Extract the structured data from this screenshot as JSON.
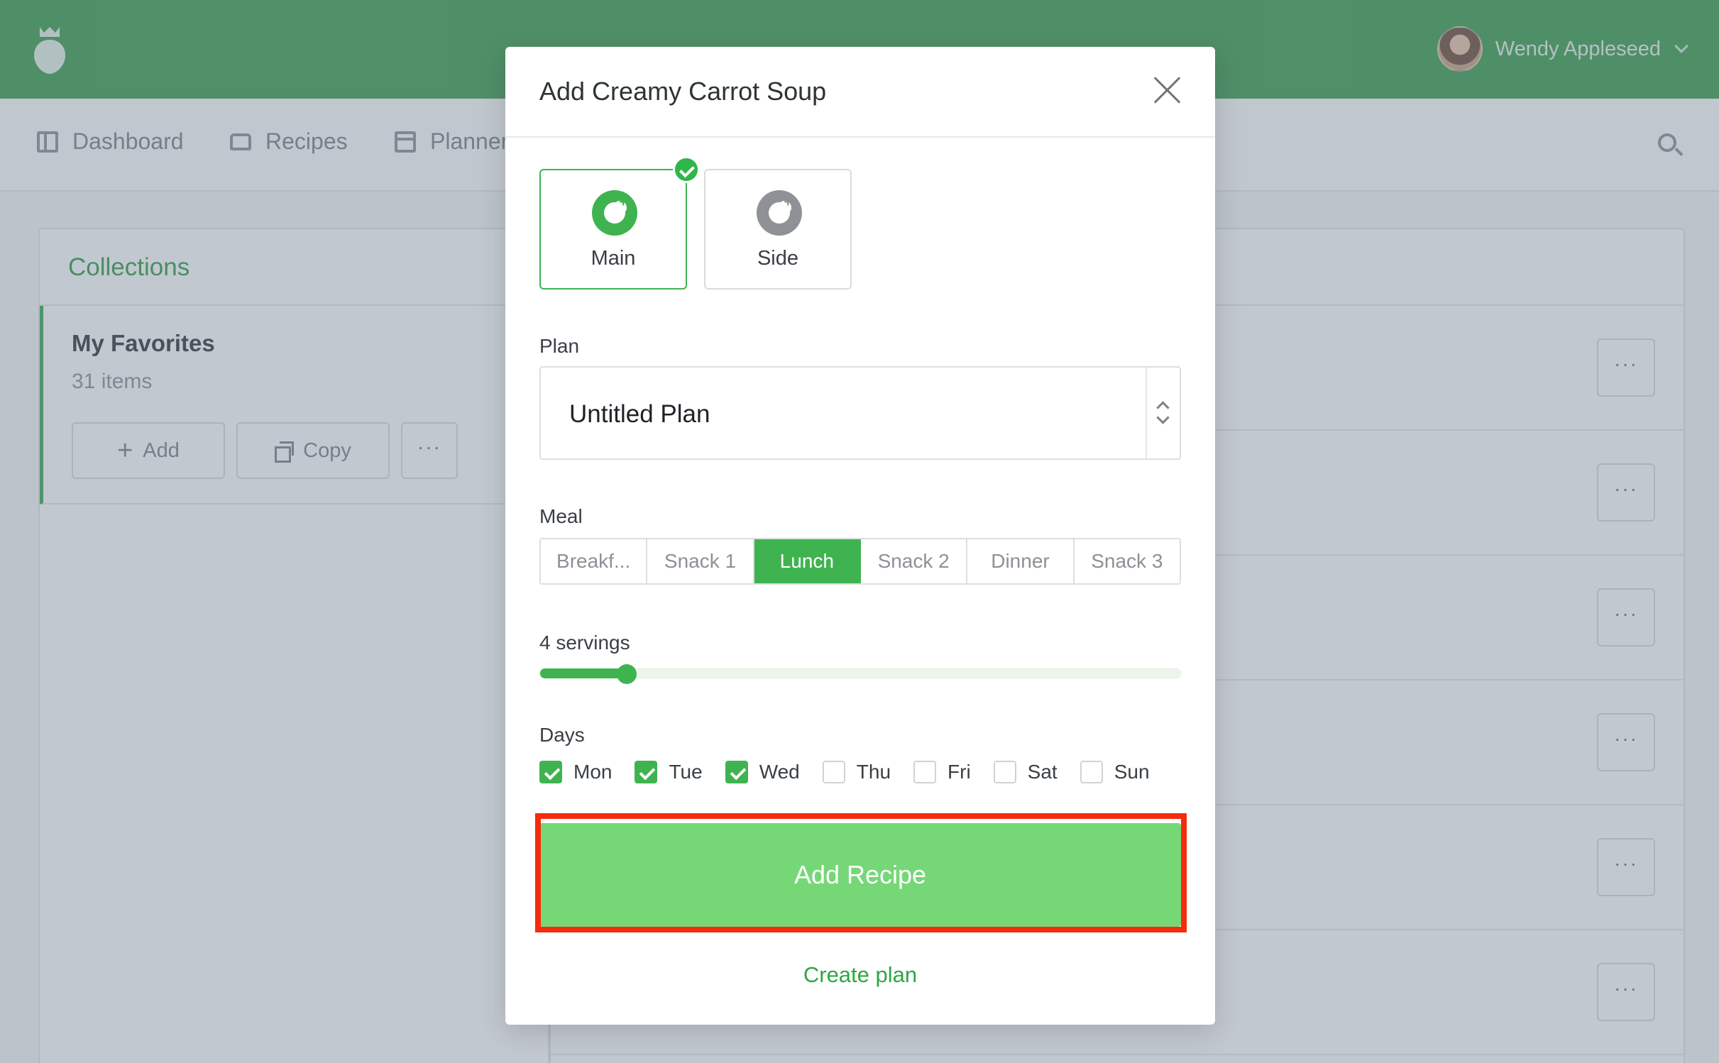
{
  "user": {
    "name": "Wendy Appleseed"
  },
  "nav": {
    "items": [
      {
        "label": "Dashboard",
        "icon": "dashboard-icon"
      },
      {
        "label": "Recipes",
        "icon": "tray-icon"
      },
      {
        "label": "Planner",
        "icon": "calendar-icon"
      }
    ]
  },
  "collections": {
    "title": "Collections",
    "favorites": {
      "title": "My Favorites",
      "count": "31 items",
      "add_label": "Add",
      "copy_label": "Copy",
      "more_label": "···"
    }
  },
  "list": {
    "more_label": "···",
    "rows": 6
  },
  "modal": {
    "title": "Add Creamy Carrot Soup",
    "types": [
      {
        "label": "Main",
        "selected": true
      },
      {
        "label": "Side",
        "selected": false
      }
    ],
    "plan_label": "Plan",
    "plan_value": "Untitled Plan",
    "meal_label": "Meal",
    "meals": [
      "Breakf...",
      "Snack 1",
      "Lunch",
      "Snack 2",
      "Dinner",
      "Snack 3"
    ],
    "selected_meal": "Lunch",
    "servings_label": "4 servings",
    "servings_fraction": 0.135,
    "days_label": "Days",
    "days": [
      {
        "label": "Mon",
        "checked": true
      },
      {
        "label": "Tue",
        "checked": true
      },
      {
        "label": "Wed",
        "checked": true
      },
      {
        "label": "Thu",
        "checked": false
      },
      {
        "label": "Fri",
        "checked": false
      },
      {
        "label": "Sat",
        "checked": false
      },
      {
        "label": "Sun",
        "checked": false
      }
    ],
    "submit_label": "Add Recipe",
    "create_plan_label": "Create plan"
  },
  "colors": {
    "brand_green": "#3a9e4e",
    "accent_green": "#3fb34f",
    "submit_green": "#76d777",
    "highlight_red": "#f52c0c"
  }
}
